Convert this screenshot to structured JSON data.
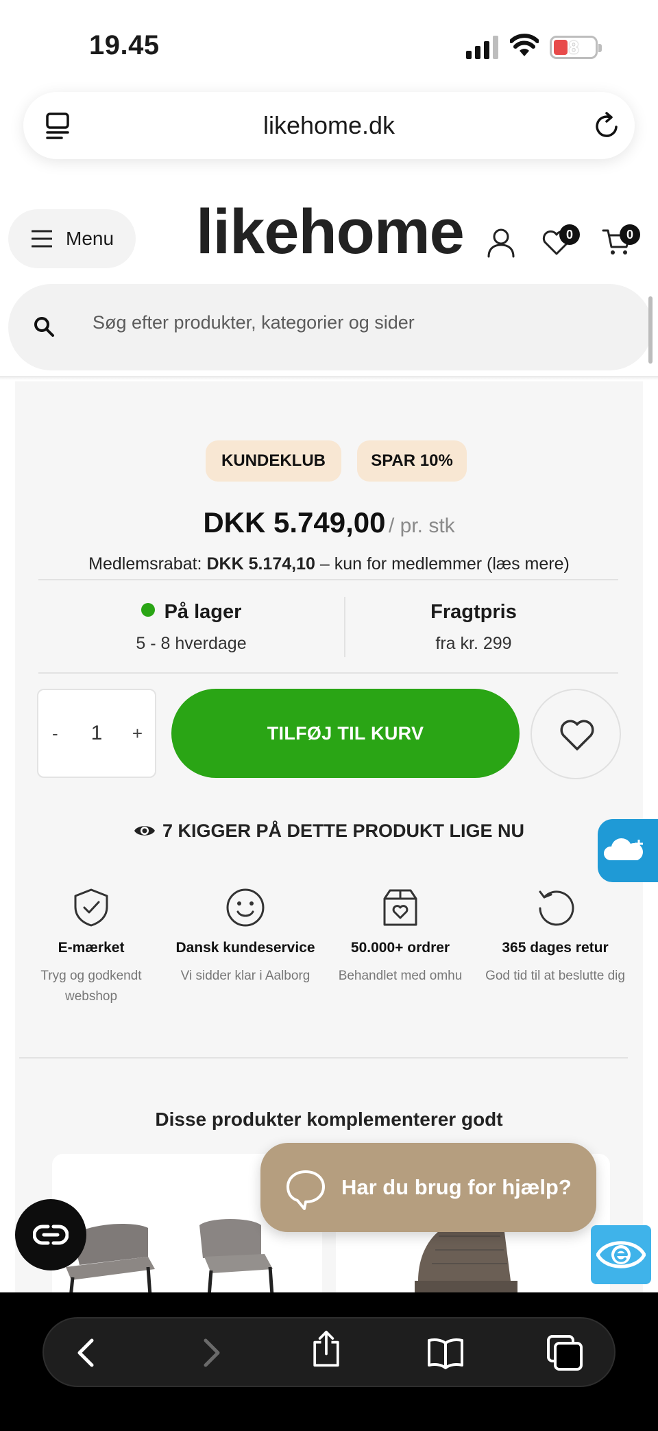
{
  "status_bar": {
    "time": "19.45",
    "battery": "8"
  },
  "browser": {
    "url": "likehome.dk"
  },
  "header": {
    "menu_label": "Menu",
    "logo_text": "likehome",
    "wishlist_count": "0",
    "cart_count": "0"
  },
  "search": {
    "placeholder": "Søg efter produkter, kategorier og sider"
  },
  "product": {
    "badges": [
      "KUNDEKLUB",
      "SPAR 10%"
    ],
    "price": "DKK 5.749,00",
    "price_unit": "/ pr. stk",
    "member_prefix": "Medlemsrabat:",
    "member_price": "DKK 5.174,10",
    "member_suffix": "– kun for medlemmer (læs mere)",
    "stock_label": "På lager",
    "stock_delivery": "5 - 8 hverdage",
    "freight_label": "Fragtpris",
    "freight_value": "fra kr. 299",
    "quantity": "1",
    "qty_minus": "-",
    "qty_plus": "+",
    "add_to_cart": "TILFØJ TIL KURV",
    "viewers": "7 KIGGER PÅ DETTE PRODUKT LIGE NU"
  },
  "usps": [
    {
      "icon": "shield-check-icon",
      "title": "E-mærket",
      "subtitle": "Tryg og godkendt webshop"
    },
    {
      "icon": "smiley-icon",
      "title": "Dansk kundeservice",
      "subtitle": "Vi sidder klar i Aalborg"
    },
    {
      "icon": "box-heart-icon",
      "title": "50.000+ ordrer",
      "subtitle": "Behandlet med omhu"
    },
    {
      "icon": "return-arrow-icon",
      "title": "365 dages retur",
      "subtitle": "God tid til at beslutte dig"
    }
  ],
  "complements": {
    "title": "Disse produkter komplementerer godt"
  },
  "help_widget": {
    "label": "Har du brug for hjælp?"
  },
  "colors": {
    "accent_green": "#2aa515",
    "badge_bg": "#f8e7d3",
    "help_bg": "#b59e7f",
    "cloud_blue": "#1f9ad6"
  }
}
